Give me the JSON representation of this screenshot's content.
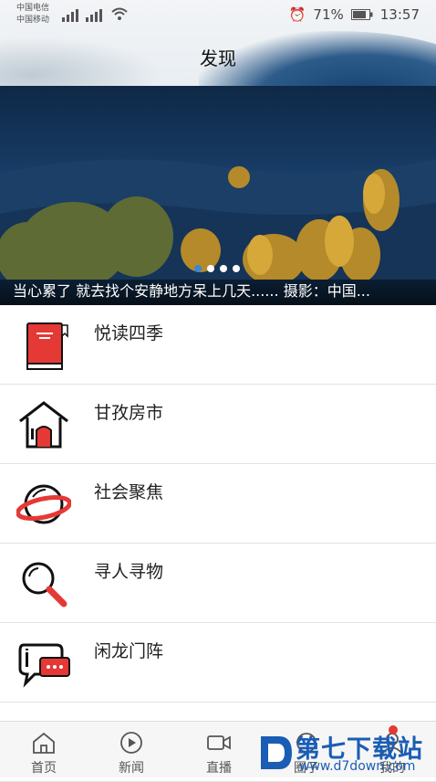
{
  "status_bar": {
    "carrier1": "中国电信",
    "carrier2": "中国移动",
    "battery": "71%",
    "time": "13:57"
  },
  "header": {
    "title": "发现"
  },
  "banner": {
    "caption": "当心累了 就去找个安静地方呆上几天......  摄影：中国...",
    "dots": 4,
    "active_dot": 0
  },
  "menu": [
    {
      "label": "悦读四季",
      "icon": "red-book-icon"
    },
    {
      "label": "甘孜房市",
      "icon": "house-icon"
    },
    {
      "label": "社会聚焦",
      "icon": "planet-icon"
    },
    {
      "label": "寻人寻物",
      "icon": "magnifier-icon"
    },
    {
      "label": "闲龙门阵",
      "icon": "chat-bubble-icon"
    }
  ],
  "tabbar": {
    "tabs": [
      {
        "label": "首页",
        "icon": "home-icon"
      },
      {
        "label": "新闻",
        "icon": "play-circle-icon"
      },
      {
        "label": "直播",
        "icon": "video-camera-icon"
      },
      {
        "label": "圈子",
        "icon": "circle-icon"
      },
      {
        "label": "我的",
        "icon": "user-icon"
      }
    ]
  },
  "watermark": {
    "title": "第七下载站",
    "url": "www.d7down.com"
  },
  "colors": {
    "accent_red": "#e53935",
    "dot_active": "#3a86d8",
    "watermark_blue": "#1a5db5"
  }
}
